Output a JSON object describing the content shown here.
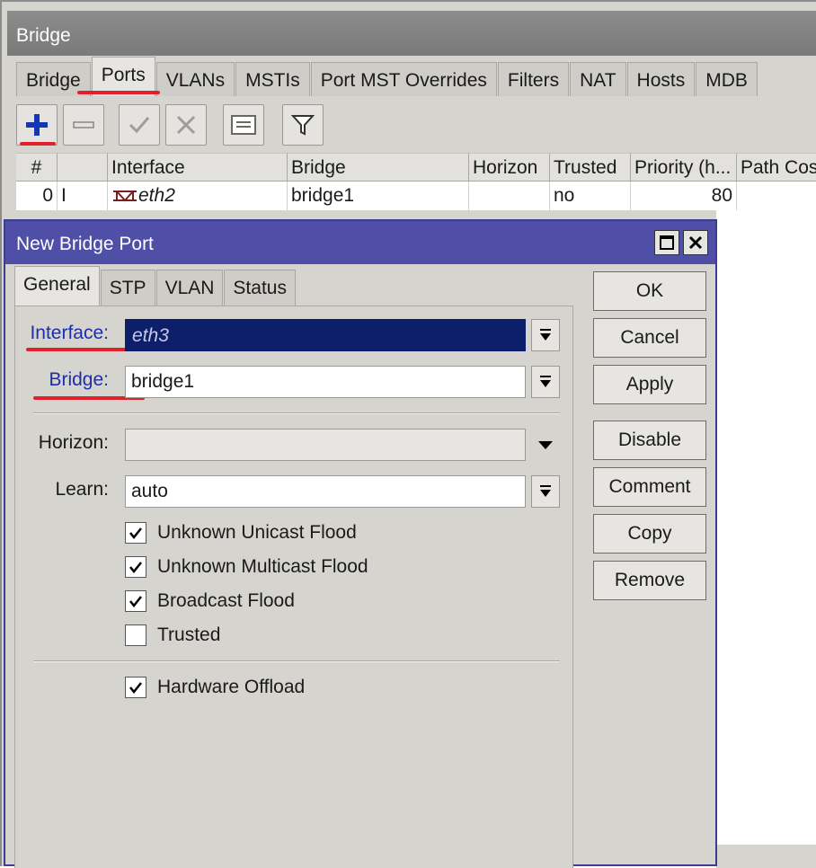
{
  "main_window": {
    "title": "Bridge",
    "tabs": [
      "Bridge",
      "Ports",
      "VLANs",
      "MSTIs",
      "Port MST Overrides",
      "Filters",
      "NAT",
      "Hosts",
      "MDB"
    ],
    "active_tab": "Ports",
    "toolbar": [
      "add-icon",
      "remove-icon",
      "enable-icon",
      "disable-icon",
      "comment-icon",
      "filter-icon"
    ],
    "table": {
      "columns": [
        "#",
        "",
        "Interface",
        "Bridge",
        "Horizon",
        "Trusted",
        "Priority (h...",
        "Path Cos"
      ],
      "rows": [
        {
          "num": "0",
          "flag": "I",
          "interface": "eth2",
          "bridge": "bridge1",
          "horizon": "",
          "trusted": "no",
          "priority": "80",
          "path_cost": ""
        }
      ]
    }
  },
  "dialog": {
    "title": "New Bridge Port",
    "tabs": [
      "General",
      "STP",
      "VLAN",
      "Status"
    ],
    "active_tab": "General",
    "fields": {
      "interface_label": "Interface:",
      "interface_value": "eth3",
      "bridge_label": "Bridge:",
      "bridge_value": "bridge1",
      "horizon_label": "Horizon:",
      "horizon_value": "",
      "learn_label": "Learn:",
      "learn_value": "auto"
    },
    "checkboxes": [
      {
        "label": "Unknown Unicast Flood",
        "checked": true
      },
      {
        "label": "Unknown Multicast Flood",
        "checked": true
      },
      {
        "label": "Broadcast Flood",
        "checked": true
      },
      {
        "label": "Trusted",
        "checked": false
      },
      {
        "label": "Hardware Offload",
        "checked": true
      }
    ],
    "buttons": [
      "OK",
      "Cancel",
      "Apply",
      "Disable",
      "Comment",
      "Copy",
      "Remove"
    ]
  },
  "colors": {
    "highlight_underline": "#e0202a",
    "dialog_title": "#4f4fa8",
    "selected_field": "#0d1f6b",
    "blue_label": "#1c2fa6"
  }
}
